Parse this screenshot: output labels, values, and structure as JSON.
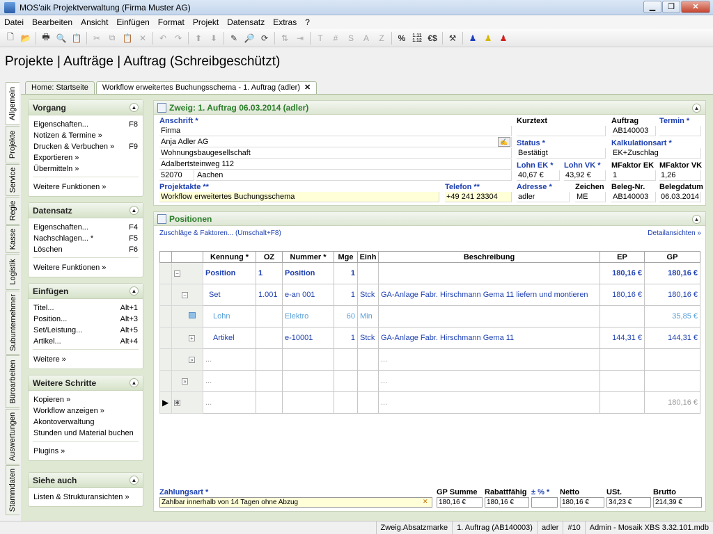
{
  "window": {
    "title": "MOS'aik Projektverwaltung (Firma Muster AG)"
  },
  "menu": [
    "Datei",
    "Bearbeiten",
    "Ansicht",
    "Einfügen",
    "Format",
    "Projekt",
    "Datensatz",
    "Extras",
    "?"
  ],
  "toolbar": {
    "percent": "%",
    "ratio_top": "1.11",
    "ratio_bottom": "1.12",
    "euro": "€$",
    "t": "T",
    "hash": "#",
    "s": "S",
    "a": "A",
    "z": "Z"
  },
  "page": {
    "title": "Projekte | Aufträge | Auftrag (Schreibgeschützt)"
  },
  "tabs": [
    {
      "label": "Home: Startseite"
    },
    {
      "label": "Workflow erweitertes Buchungsschema - 1. Auftrag (adler)"
    }
  ],
  "vtabs": [
    "Allgemein",
    "Projekte",
    "Service",
    "Regie",
    "Kasse",
    "Logistik",
    "Subunternehmer",
    "Büroarbeiten",
    "Auswertungen",
    "Stammdaten"
  ],
  "sidebar": {
    "vorgang": {
      "title": "Vorgang",
      "items": [
        {
          "label": "Eigenschaften...",
          "key": "F8"
        },
        {
          "label": "Notizen & Termine »",
          "key": ""
        },
        {
          "label": "Drucken & Verbuchen »",
          "key": "F9"
        },
        {
          "label": "Exportieren »",
          "key": ""
        },
        {
          "label": "Übermitteln »",
          "key": ""
        }
      ],
      "more": "Weitere Funktionen »"
    },
    "datensatz": {
      "title": "Datensatz",
      "items": [
        {
          "label": "Eigenschaften...",
          "key": "F4"
        },
        {
          "label": "Nachschlagen... *",
          "key": "F5"
        },
        {
          "label": "Löschen",
          "key": "F6"
        }
      ],
      "more": "Weitere Funktionen »"
    },
    "einfuegen": {
      "title": "Einfügen",
      "items": [
        {
          "label": "Titel...",
          "key": "Alt+1"
        },
        {
          "label": "Position...",
          "key": "Alt+3"
        },
        {
          "label": "Set/Leistung...",
          "key": "Alt+5"
        },
        {
          "label": "Artikel...",
          "key": "Alt+4"
        }
      ],
      "more": "Weitere »"
    },
    "weitere": {
      "title": "Weitere Schritte",
      "items": [
        {
          "label": "Kopieren »"
        },
        {
          "label": "Workflow anzeigen »"
        },
        {
          "label": "Akontoverwaltung"
        },
        {
          "label": "Stunden und Material buchen"
        }
      ],
      "more": "Plugins »"
    },
    "siehe": {
      "title": "Siehe auch",
      "items": [
        {
          "label": "Listen & Strukturansichten »"
        }
      ]
    }
  },
  "zweig": {
    "title": "Zweig: 1. Auftrag 06.03.2014 (adler)",
    "anschrift_label": "Anschrift *",
    "anschrift": [
      "Firma",
      "Anja Adler AG",
      "Wohnungsbaugesellschaft",
      "Adalbertsteinweg 112"
    ],
    "plz": "52070",
    "ort": "Aachen",
    "projektakte_label": "Projektakte **",
    "projektakte": "Workflow erweitertes Buchungsschema",
    "telefon_label": "Telefon **",
    "telefon": "+49 241 23304",
    "kurztext_label": "Kurztext",
    "kurztext": "",
    "auftrag_label": "Auftrag",
    "auftrag": "AB140003",
    "termin_label": "Termin *",
    "termin": "",
    "status_label": "Status *",
    "status": "Bestätigt",
    "kalk_label": "Kalkulationsart *",
    "kalk": "EK+Zuschlag",
    "lohn_ek_label": "Lohn EK *",
    "lohn_ek": "40,67 €",
    "lohn_vk_label": "Lohn VK *",
    "lohn_vk": "43,92 €",
    "mfaktor_ek_label": "MFaktor EK",
    "mfaktor_ek": "1",
    "mfaktor_vk_label": "MFaktor VK",
    "mfaktor_vk": "1,26",
    "adresse_label": "Adresse *",
    "adresse": "adler",
    "zeichen_label": "Zeichen",
    "zeichen": "ME",
    "belegnr_label": "Beleg-Nr.",
    "belegnr": "AB140003",
    "belegdatum_label": "Belegdatum",
    "belegdatum": "06.03.2014"
  },
  "positionen": {
    "title": "Positionen",
    "zuschlaege": "Zuschläge & Faktoren... (Umschalt+F8)",
    "detail": "Detailansichten »",
    "columns": [
      "Kennung *",
      "OZ",
      "Nummer *",
      "Mge",
      "Einh",
      "Beschreibung",
      "EP",
      "GP"
    ],
    "rows": [
      {
        "kennung": "Position",
        "oz": "1",
        "nummer": "Position",
        "mge": "1",
        "einh": "",
        "beschreibung": "",
        "ep": "180,16 €",
        "gp": "180,16 €"
      },
      {
        "kennung": "Set",
        "oz": "1.001",
        "nummer": "e-an 001",
        "mge": "1",
        "einh": "Stck",
        "beschreibung": "GA-Anlage Fabr. Hirschmann Gema 11 liefern und montieren",
        "ep": "180,16 €",
        "gp": "180,16 €"
      },
      {
        "kennung": "Lohn",
        "oz": "",
        "nummer": "Elektro",
        "mge": "60",
        "einh": "Min",
        "beschreibung": "",
        "ep": "",
        "gp": "35,85 €"
      },
      {
        "kennung": "Artikel",
        "oz": "",
        "nummer": "e-10001",
        "mge": "1",
        "einh": "Stck",
        "beschreibung": "GA-Anlage Fabr. Hirschmann Gema 11",
        "ep": "144,31 €",
        "gp": "144,31 €"
      },
      {
        "kennung": "...",
        "oz": "",
        "nummer": "",
        "mge": "",
        "einh": "",
        "beschreibung": "...",
        "ep": "",
        "gp": ""
      },
      {
        "kennung": "...",
        "oz": "",
        "nummer": "",
        "mge": "",
        "einh": "",
        "beschreibung": "...",
        "ep": "",
        "gp": ""
      },
      {
        "kennung": "...",
        "oz": "",
        "nummer": "",
        "mge": "",
        "einh": "",
        "beschreibung": "...",
        "ep": "",
        "gp": "180,16 €"
      }
    ]
  },
  "footer": {
    "zahlungsart_label": "Zahlungsart *",
    "zahlungsart": "Zahlbar innerhalb von 14 Tagen ohne Abzug",
    "gp_summe_label": "GP Summe",
    "gp_summe": "180,16 €",
    "rabattfaehig_label": "Rabattfähig",
    "rabattfaehig": "180,16 €",
    "pm_label": "± % *",
    "pm": "",
    "netto_label": "Netto",
    "netto": "180,16 €",
    "ust_label": "USt.",
    "ust": "34,23 €",
    "brutto_label": "Brutto",
    "brutto": "214,39 €"
  },
  "status": [
    "Zweig.Absatzmarke",
    "1. Auftrag (AB140003)",
    "adler",
    "#10",
    "Admin - Mosaik XBS 3.32.101.mdb"
  ]
}
